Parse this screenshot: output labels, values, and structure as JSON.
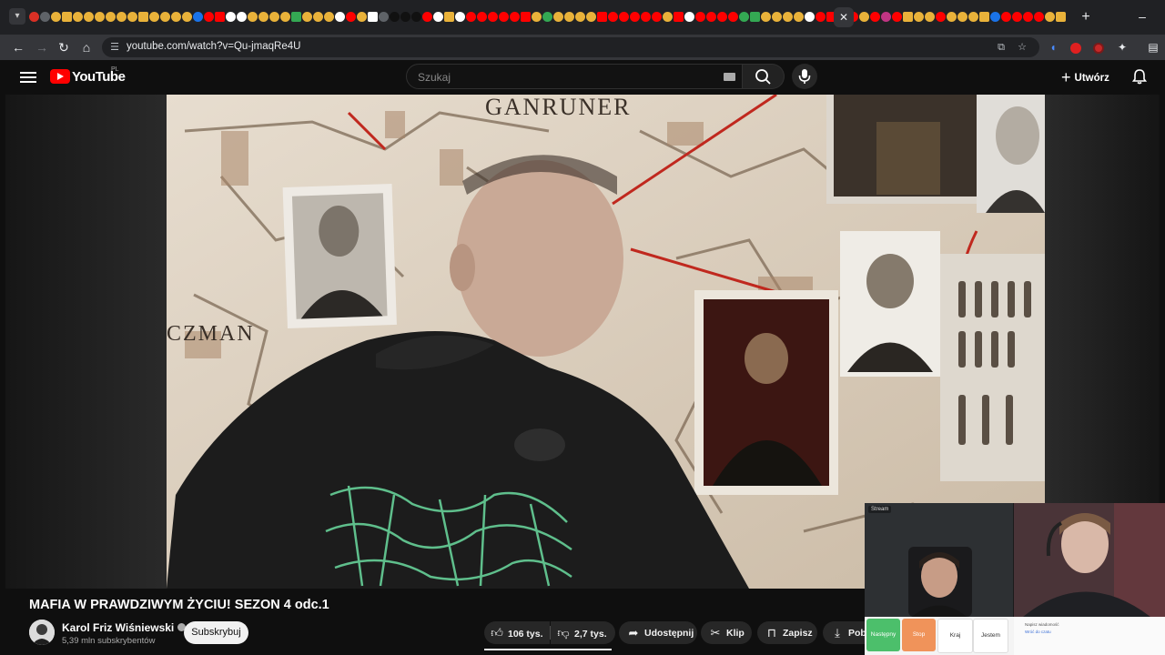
{
  "browser": {
    "url": "youtube.com/watch?v=Qu-jmaqRe4U",
    "tab_favicon_colors": [
      "#d93025",
      "#5f6368",
      "#e9b23a",
      "#e9b23a",
      "#e9b23a",
      "#e9b23a",
      "#e9b23a",
      "#e9b23a",
      "#e9b23a",
      "#e9b23a",
      "#e9b23a",
      "#e9b23a",
      "#e9b23a",
      "#e9b23a",
      "#e9b23a",
      "#1a73e8",
      "#ff0000",
      "#ff0000",
      "#ffffff",
      "#ffffff",
      "#e9b23a",
      "#e9b23a",
      "#e9b23a",
      "#e9b23a",
      "#34a853",
      "#e9b23a",
      "#e9b23a",
      "#e9b23a",
      "#ffffff",
      "#ff0000",
      "#e9b23a",
      "#ffffff",
      "#5f6368",
      "#111111",
      "#111111",
      "#111111",
      "#ff0000",
      "#ffffff",
      "#e9b23a",
      "#ffffff",
      "#ff0000",
      "#ff0000",
      "#ff0000",
      "#ff0000",
      "#ff0000",
      "#ff0000",
      "#e9b23a",
      "#34a853",
      "#e9b23a",
      "#e9b23a",
      "#e9b23a",
      "#e9b23a",
      "#ff0000",
      "#ff0000",
      "#ff0000",
      "#ff0000",
      "#ff0000",
      "#ff0000",
      "#e9b23a",
      "#ff0000",
      "#ffffff",
      "#ff0000",
      "#ff0000",
      "#ff0000",
      "#ff0000",
      "#34a853",
      "#34a853",
      "#e9b23a",
      "#e9b23a",
      "#e9b23a",
      "#e9b23a",
      "#ffffff",
      "#ff0000",
      "#ff0000",
      "#ff0000",
      "#ff0000",
      "#e9b23a",
      "#ff0000",
      "#c13584",
      "#ff0000",
      "#e9b23a",
      "#e9b23a",
      "#e9b23a",
      "#ff0000",
      "#e9b23a",
      "#e9b23a",
      "#e9b23a",
      "#e9b23a",
      "#1a73e8",
      "#ff0000",
      "#ff0000",
      "#ff0000",
      "#ff0000",
      "#e9b23a",
      "#e9b23a",
      "#e9b23a",
      "#e9b23a",
      "#34a853",
      "#34a853",
      "#ff0000",
      "#ff0000",
      "#ff0000",
      "#ff0000",
      "#ff0000",
      "#ff0000",
      "#ff0000",
      "#e9b23a",
      "#e9b23a",
      "#e9b23a",
      "#e9b23a"
    ],
    "icons": {
      "tab_search": "chevron-down-icon",
      "close_tab": "close-icon",
      "new_tab": "plus-icon",
      "minimize": "minimize-icon"
    }
  },
  "youtube": {
    "logo_text": "YouTube",
    "country_code": "PL",
    "search_placeholder": "Szukaj",
    "create_label": "Utwórz",
    "brand_red": "#ff0000"
  },
  "video": {
    "title": "MAFIA W PRAWDZIWYM ŻYCIU! SEZON 4 odc.1",
    "scene_wall_texts": [
      "GANRUNER",
      "CZMAN"
    ],
    "channel": {
      "name": "Karol Friz Wiśniewski",
      "subscribers": "5,39 mln subskrybentów",
      "subscribe_label": "Subskrybuj"
    },
    "actions": {
      "likes": "106 tys.",
      "dislikes": "2,7 tys.",
      "share": "Udostępnij",
      "clip": "Klip",
      "save": "Zapisz",
      "download": "Pob"
    }
  },
  "overlay": {
    "cam_label_left": "Stream",
    "vote_options": [
      "Następny",
      "Stop",
      "Kraj",
      "Jestem"
    ],
    "vote_colors": [
      "#4cbf6b",
      "#f0935a",
      "#ffffff",
      "#ffffff"
    ],
    "chat_lines": [
      "Napisz wiadomość",
      "Wróć do czatu"
    ]
  }
}
